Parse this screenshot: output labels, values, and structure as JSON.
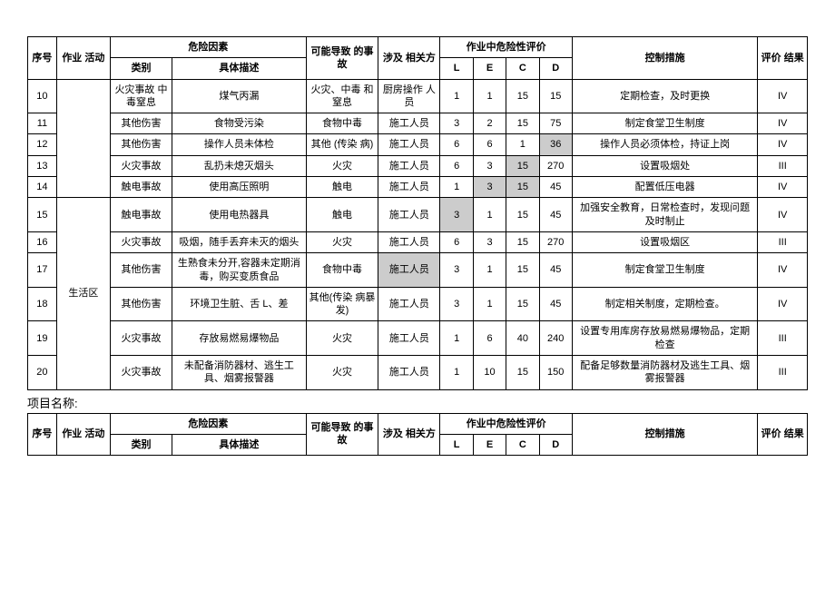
{
  "headers": {
    "seq": "序号",
    "act": "作业 活动",
    "risk": "危险因素",
    "cat": "类别",
    "desc": "具体描述",
    "acc": "可能导致 的事故",
    "party": "涉及 相关方",
    "eval": "作业中危险性评价",
    "L": "L",
    "E": "E",
    "C": "C",
    "D": "D",
    "ctrl": "控制措施",
    "res": "评价 结果"
  },
  "activity_merged": "生活区",
  "rows": [
    {
      "seq": "10",
      "cat": "火灾事故 中毒窒息",
      "desc": "煤气丙漏",
      "acc": "火灾、中毒 和窒息",
      "party": "厨房操作 人员",
      "L": "1",
      "E": "1",
      "C": "15",
      "D": "15",
      "ctrl": "定期检查，及时更换",
      "res": "IV"
    },
    {
      "seq": "11",
      "cat": "其他伤害",
      "desc": "食物受污染",
      "acc": "食物中毒",
      "party": "施工人员",
      "L": "3",
      "E": "2",
      "C": "15",
      "D": "75",
      "ctrl": "制定食堂卫生制度",
      "res": "IV"
    },
    {
      "seq": "12",
      "cat": "其他伤害",
      "desc": "操作人员未体检",
      "acc": "其他 (传染 病)",
      "party": "施工人员",
      "L": "6",
      "E": "6",
      "C": "1",
      "D": "36",
      "ctrl": "操作人员必须体检，持证上岗",
      "res": "IV",
      "shade": [
        "D"
      ]
    },
    {
      "seq": "13",
      "cat": "火灾事故",
      "desc": "乱扔未熄灭烟头",
      "acc": "火灾",
      "party": "施工人员",
      "L": "6",
      "E": "3",
      "C": "15",
      "D": "270",
      "ctrl": "设置吸烟处",
      "res": "III",
      "shade": [
        "C"
      ]
    },
    {
      "seq": "14",
      "cat": "触电事故",
      "desc": "使用高压照明",
      "acc": "触电",
      "party": "施工人员",
      "L": "1",
      "E": "3",
      "C": "15",
      "D": "45",
      "ctrl": "配置低压电器",
      "res": "IV",
      "shade": [
        "E",
        "C"
      ]
    },
    {
      "seq": "15",
      "cat": "触电事故",
      "desc": "使用电热器具",
      "acc": "触电",
      "party": "施工人员",
      "L": "3",
      "E": "1",
      "C": "15",
      "D": "45",
      "ctrl": "加强安全教育，日常检查时，发现问题 及时制止",
      "res": "IV",
      "shade": [
        "L"
      ]
    },
    {
      "seq": "16",
      "cat": "火灾事故",
      "desc": "吸烟，随手丢弃未灭的烟头",
      "acc": "火灾",
      "party": "施工人员",
      "L": "6",
      "E": "3",
      "C": "15",
      "D": "270",
      "ctrl": "设置吸烟区",
      "res": "III"
    },
    {
      "seq": "17",
      "cat": "其他伤害",
      "desc": "生熟食未分开,容器未定期消毒，购买变质食品",
      "acc": "食物中毒",
      "party": "施工人员",
      "L": "3",
      "E": "1",
      "C": "15",
      "D": "45",
      "ctrl": "制定食堂卫生制度",
      "res": "IV",
      "shade": [
        "party"
      ]
    },
    {
      "seq": "18",
      "cat": "其他伤害",
      "desc": "环境卫生脏、舌 L、差",
      "acc": "其他(传染 病暴发)",
      "party": "施工人员",
      "L": "3",
      "E": "1",
      "C": "15",
      "D": "45",
      "ctrl": "制定相关制度，定期检查。",
      "res": "IV"
    },
    {
      "seq": "19",
      "cat": "火灾事故",
      "desc": "存放易燃易爆物品",
      "acc": "火灾",
      "party": "施工人员",
      "L": "1",
      "E": "6",
      "C": "40",
      "D": "240",
      "ctrl": "设置专用库房存放易燃易爆物品，定期 检查",
      "res": "III"
    },
    {
      "seq": "20",
      "cat": "火灾事故",
      "desc": "未配备消防器材、逃生工 具、烟雾报警器",
      "acc": "火灾",
      "party": "施工人员",
      "L": "1",
      "E": "10",
      "C": "15",
      "D": "150",
      "ctrl": "配备足够数量消防器材及逃生工具、烟 雾报警器",
      "res": "III"
    }
  ],
  "section_label": "项目名称:"
}
